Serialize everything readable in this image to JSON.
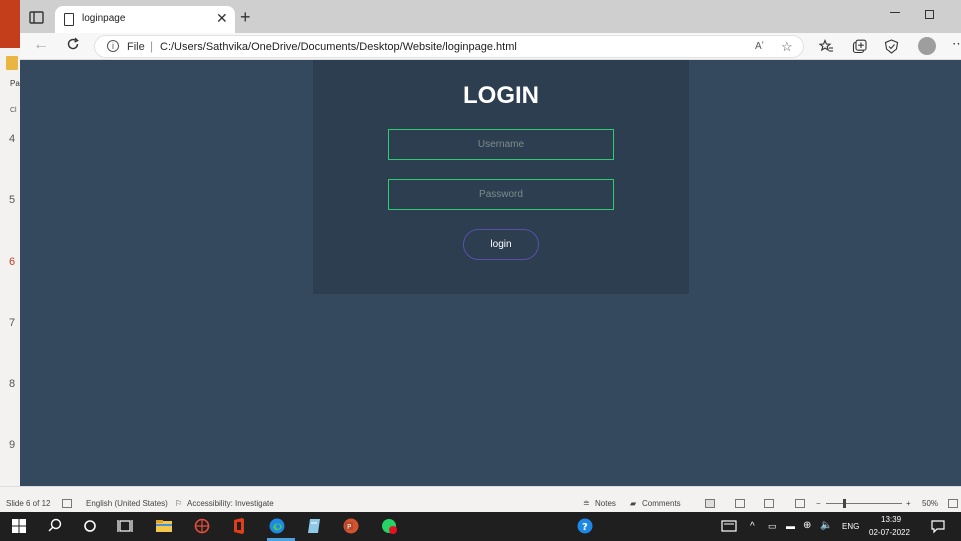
{
  "powerpoint": {
    "slide_numbers": [
      "4",
      "5",
      "6",
      "7",
      "8",
      "9"
    ],
    "active_slide": "6",
    "status": {
      "slide_info": "Slide 6 of 12",
      "language": "English (United States)",
      "accessibility": "Accessibility: Investigate",
      "notes": "Notes",
      "comments": "Comments",
      "zoom": "50%"
    }
  },
  "browser": {
    "tab": {
      "title": "loginpage"
    },
    "address": {
      "scheme_label": "File",
      "separator": "|",
      "url": "C:/Users/Sathvika/OneDrive/Documents/Desktop/Website/loginpage.html"
    }
  },
  "page": {
    "title": "LOGIN",
    "username_placeholder": "Username",
    "password_placeholder": "Password",
    "login_button": "login"
  },
  "taskbar": {
    "language": "ENG",
    "time": "13:39",
    "date": "02-07-2022"
  },
  "colors": {
    "page_background": "#34495e",
    "panel_background": "#2c3e50",
    "input_border": "#2ecc71",
    "button_border": "#5b4fa8",
    "powerpoint_accent": "#c43e1c"
  }
}
